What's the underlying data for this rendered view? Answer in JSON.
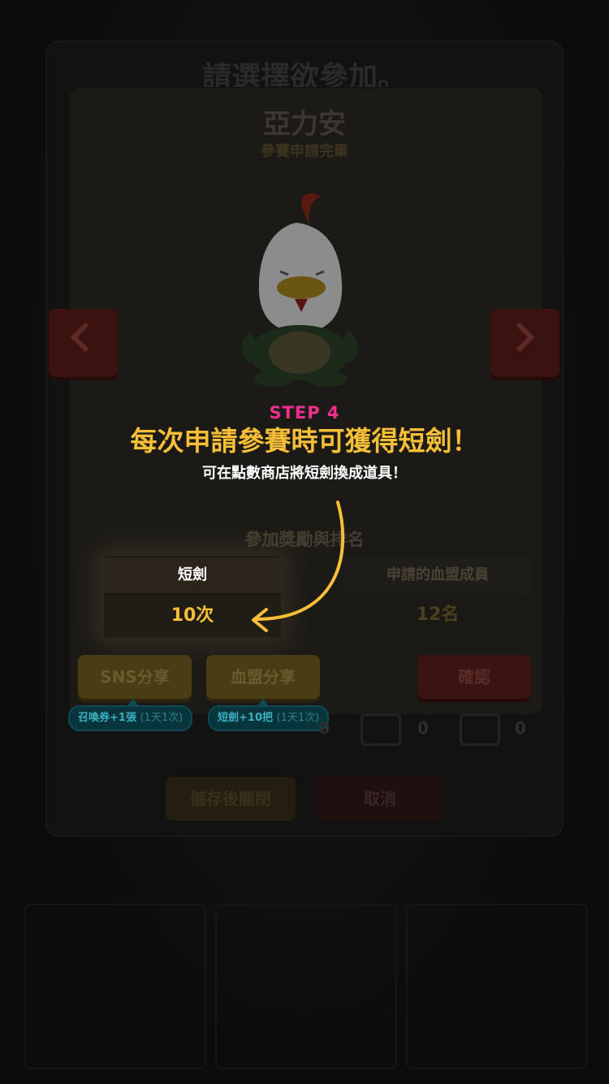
{
  "background": {
    "outer_title": "請選擇欲參加。",
    "dialog": {
      "name": "亞力安",
      "status": "參賽申請完畢",
      "rewards_title": "參加獎勵與排名",
      "columns": [
        {
          "header": "短劍",
          "value": "10次"
        },
        {
          "header": "申請的血盟成員",
          "value": "12名"
        }
      ],
      "buttons": {
        "sns_share": "SNS分享",
        "clan_share": "血盟分享",
        "confirm": "確認"
      },
      "tips": [
        {
          "main": "召喚券+1張",
          "note": "(1天1次)"
        },
        {
          "main": "短劍+10把",
          "note": "(1天1次)"
        }
      ]
    },
    "counts": [
      "0",
      "0",
      "0"
    ],
    "bottom_buttons": {
      "save": "儲存後關閉",
      "cancel": "取消"
    }
  },
  "tutorial": {
    "step": "STEP 4",
    "headline": "每次申請參賽時可獲得短劍！",
    "subline": "可在點數商店將短劍換成道具！"
  },
  "colors": {
    "accent_gold": "#f7be37",
    "step_pink": "#ee2f8e"
  }
}
